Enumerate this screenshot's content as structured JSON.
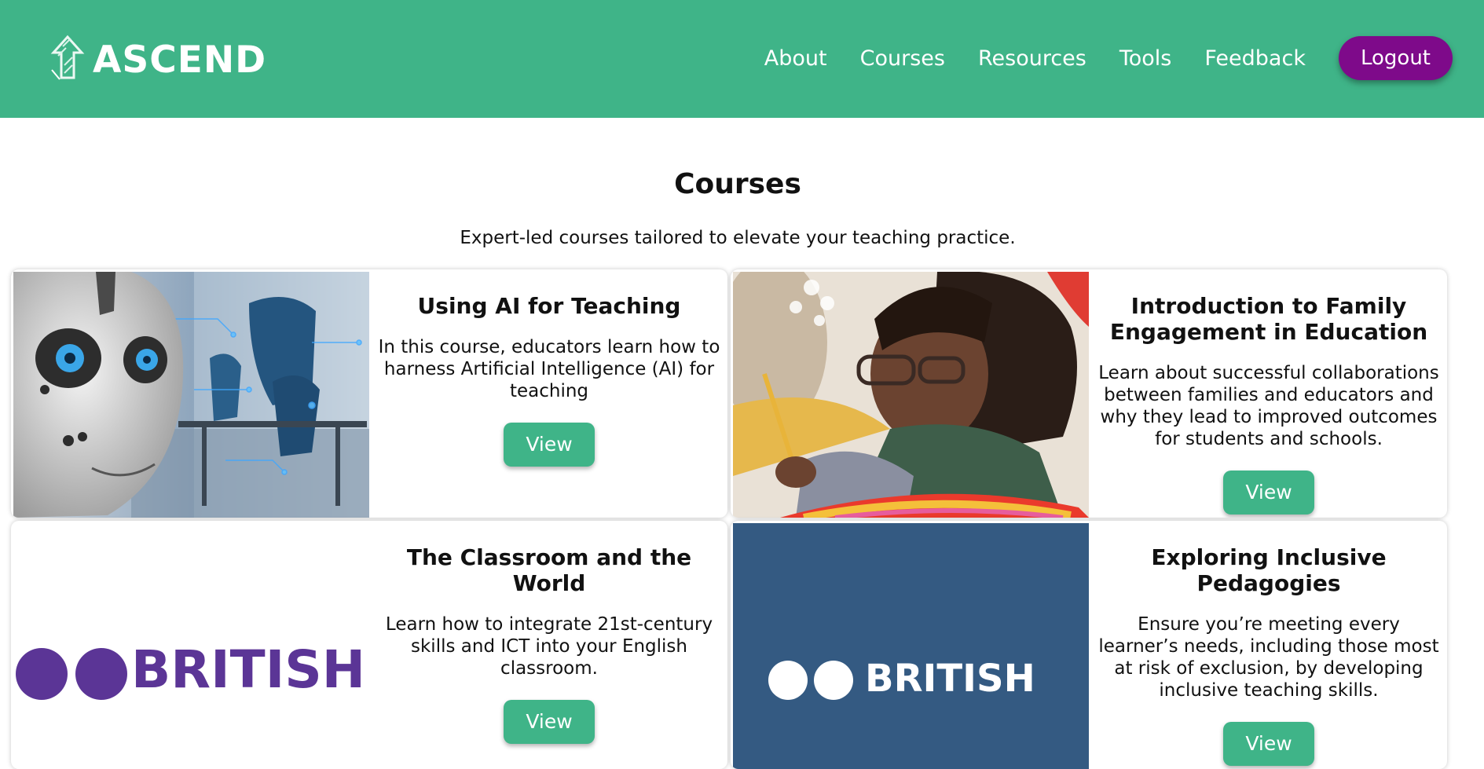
{
  "header": {
    "brand": "ASCEND",
    "nav": [
      "About",
      "Courses",
      "Resources",
      "Tools",
      "Feedback"
    ],
    "logout_label": "Logout",
    "colors": {
      "header_bg": "#3fb488",
      "logout_bg": "#7e0a8a"
    }
  },
  "page": {
    "title": "Courses",
    "subtitle": "Expert-led courses tailored to elevate your teaching practice."
  },
  "courses": [
    {
      "title": "Using AI for Teaching",
      "description": "In this course, educators learn how to harness Artificial Intelligence (AI) for teaching",
      "button": "View",
      "image": "robot-classroom-image"
    },
    {
      "title": "Introduction to Family Engagement in Education",
      "description": "Learn about successful collaborations between families and educators and why they lead to improved outcomes for students and schools.",
      "button": "View",
      "image": "child-writing-image"
    },
    {
      "title": "The Classroom and the World",
      "description": "Learn how to integrate 21st-century skills and ICT into your English classroom.",
      "button": "View",
      "image": "british-council-logo-white",
      "image_text": "BRITISH"
    },
    {
      "title": "Exploring Inclusive Pedagogies",
      "description": "Ensure you’re meeting every learner’s needs, including those most at risk of exclusion, by developing inclusive teaching skills.",
      "button": "View",
      "image": "british-council-logo-blue",
      "image_text": "BRITISH"
    }
  ]
}
